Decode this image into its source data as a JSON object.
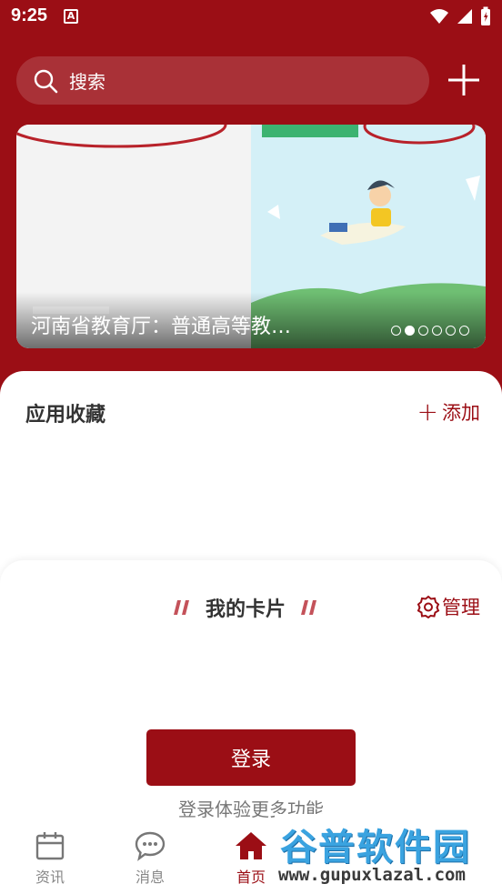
{
  "status_bar": {
    "time": "9:25",
    "notification_badge": "A"
  },
  "search": {
    "placeholder": "搜索"
  },
  "banner": {
    "title": "河南省教育厅：普通高等教…",
    "active_slide": 2,
    "slide_count": 6
  },
  "apps": {
    "title": "应用收藏",
    "add_label": "添加"
  },
  "cards": {
    "title": "我的卡片",
    "manage_label": "管理"
  },
  "login": {
    "button_label": "登录",
    "hint": "登录体验更多功能"
  },
  "bottom_nav": {
    "items": [
      {
        "label": "资讯",
        "icon": "calendar-icon"
      },
      {
        "label": "消息",
        "icon": "chat-bubble-icon"
      },
      {
        "label": "首页",
        "icon": "home-icon"
      }
    ],
    "active": "首页"
  },
  "watermark": {
    "title": "谷普软件园",
    "url": "www.gupuxlazal.com"
  },
  "colors": {
    "brand": "#9b0e15",
    "watermark_blue": "#3aa3e0"
  }
}
